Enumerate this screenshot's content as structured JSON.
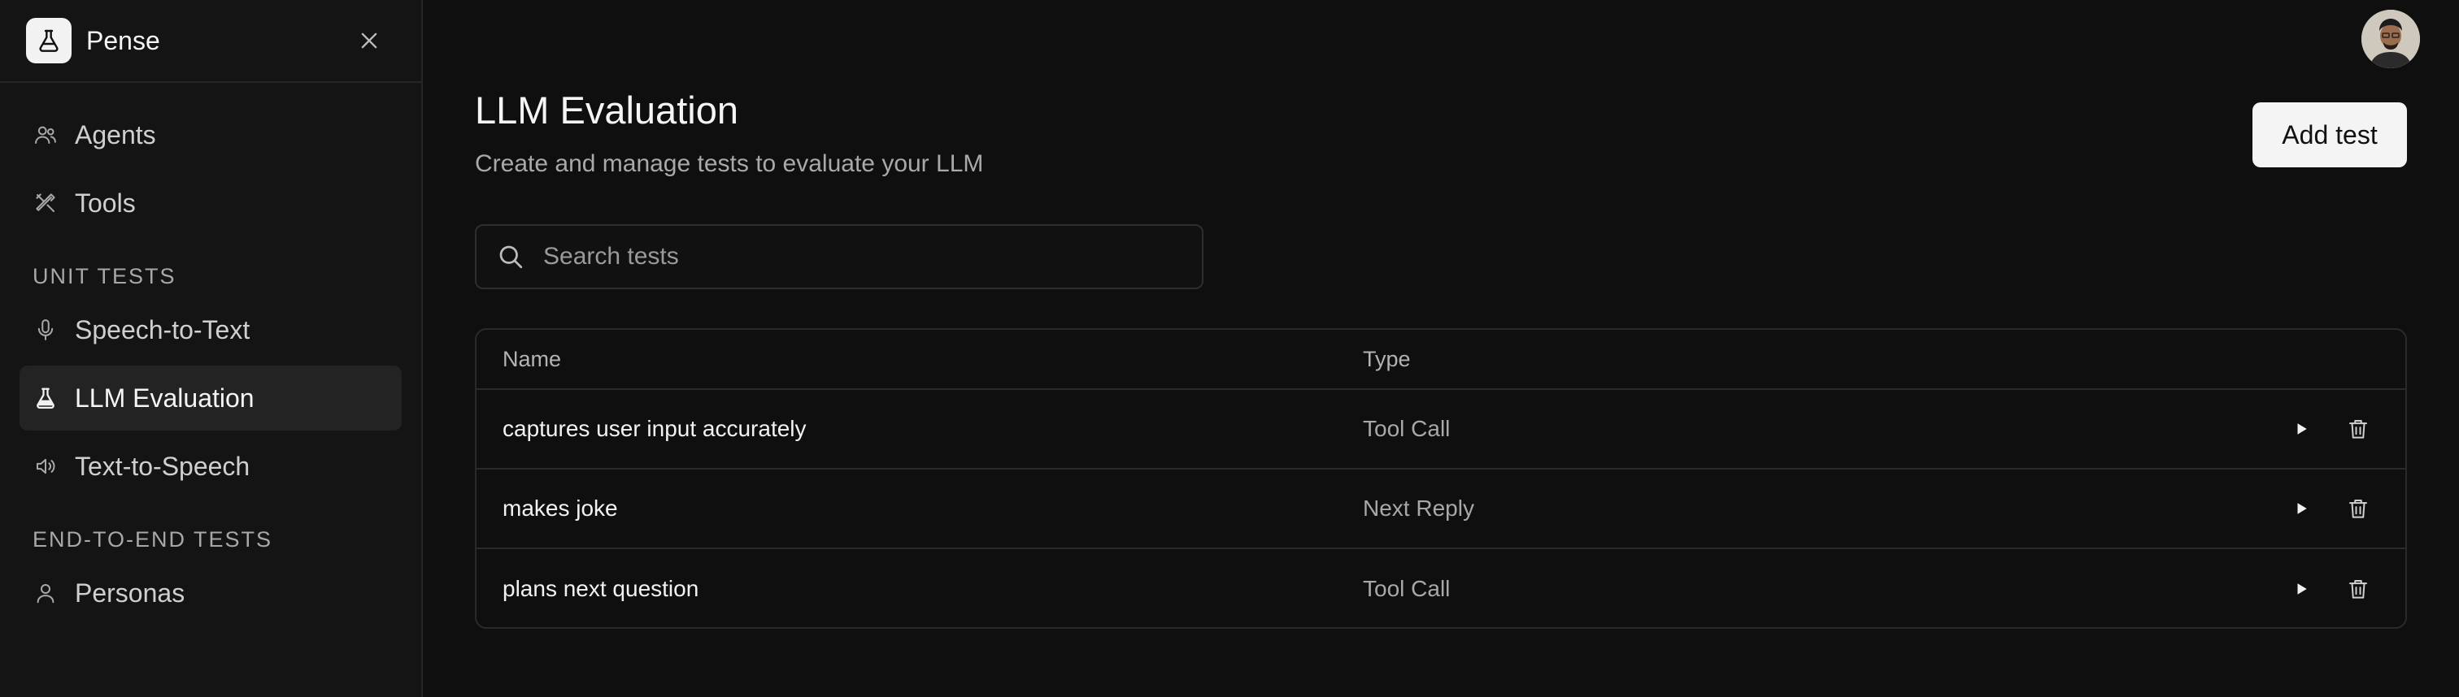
{
  "sidebar": {
    "brand": "Pense",
    "items_top": [
      {
        "label": "Agents",
        "icon": "users-icon"
      },
      {
        "label": "Tools",
        "icon": "tools-icon"
      }
    ],
    "section_unit": "UNIT TESTS",
    "items_unit": [
      {
        "label": "Speech-to-Text",
        "icon": "microphone-icon"
      },
      {
        "label": "LLM Evaluation",
        "icon": "flask-icon",
        "active": true
      },
      {
        "label": "Text-to-Speech",
        "icon": "speaker-icon"
      }
    ],
    "section_e2e": "END-TO-END TESTS",
    "items_e2e": [
      {
        "label": "Personas",
        "icon": "user-icon"
      }
    ]
  },
  "main": {
    "title": "LLM Evaluation",
    "subtitle": "Create and manage tests to evaluate your LLM",
    "add_button": "Add test",
    "search_placeholder": "Search tests",
    "table": {
      "headers": {
        "name": "Name",
        "type": "Type"
      },
      "rows": [
        {
          "name": "captures user input accurately",
          "type": "Tool Call"
        },
        {
          "name": "makes joke",
          "type": "Next Reply"
        },
        {
          "name": "plans next question",
          "type": "Tool Call"
        }
      ]
    }
  },
  "colors": {
    "background": "#0f0f0f",
    "sidebar": "#141414",
    "active_item": "#232323",
    "button": "#f4f4f4"
  }
}
